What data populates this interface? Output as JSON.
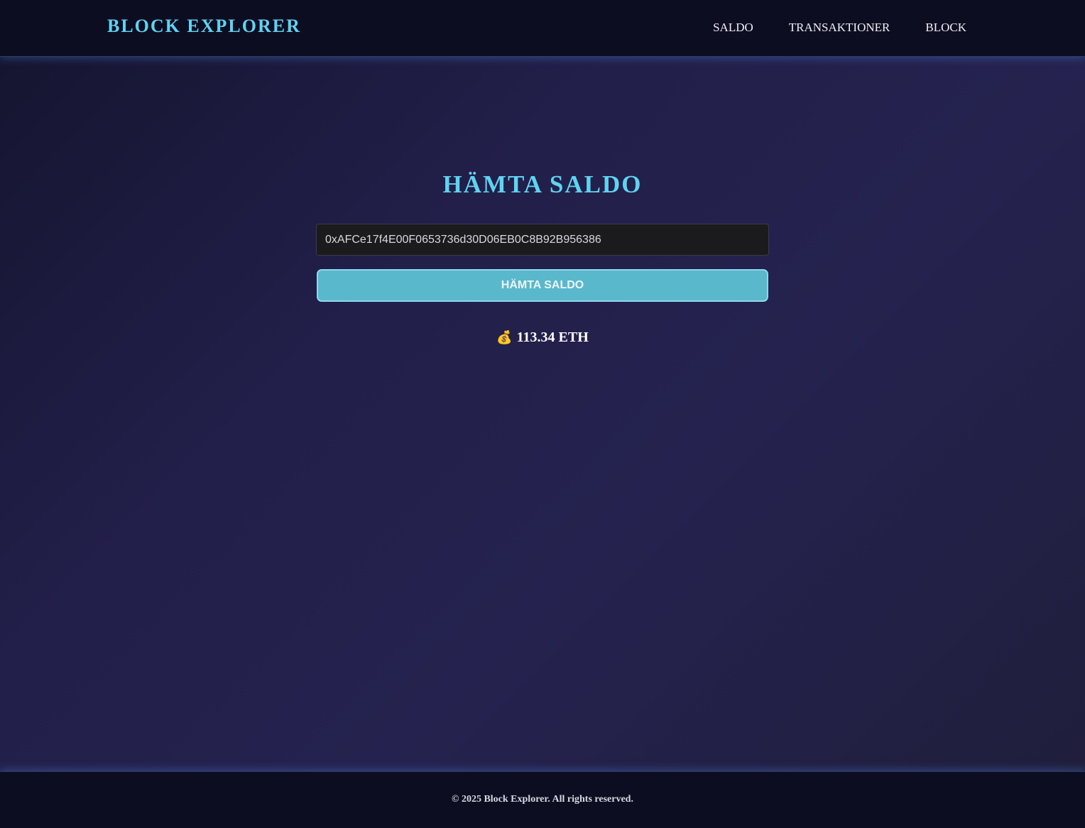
{
  "header": {
    "brand": "BLOCK EXPLORER",
    "nav": [
      {
        "label": "SALDO"
      },
      {
        "label": "TRANSAKTIONER"
      },
      {
        "label": "BLOCK"
      }
    ]
  },
  "main": {
    "title": "HÄMTA SALDO",
    "address_input": {
      "value": "0xAFCe17f4E00F0653736d30D06EB0C8B92B956386"
    },
    "fetch_button_label": "HÄMTA SALDO",
    "result": {
      "icon": "money-bag-icon",
      "icon_glyph": "💰",
      "value": "113.34 ETH"
    }
  },
  "footer": {
    "copyright": "© 2025 Block Explorer. All rights reserved."
  },
  "colors": {
    "accent": "#5fd3f0",
    "button": "#5ab8cc",
    "bar_bg": "#0d0d22"
  }
}
